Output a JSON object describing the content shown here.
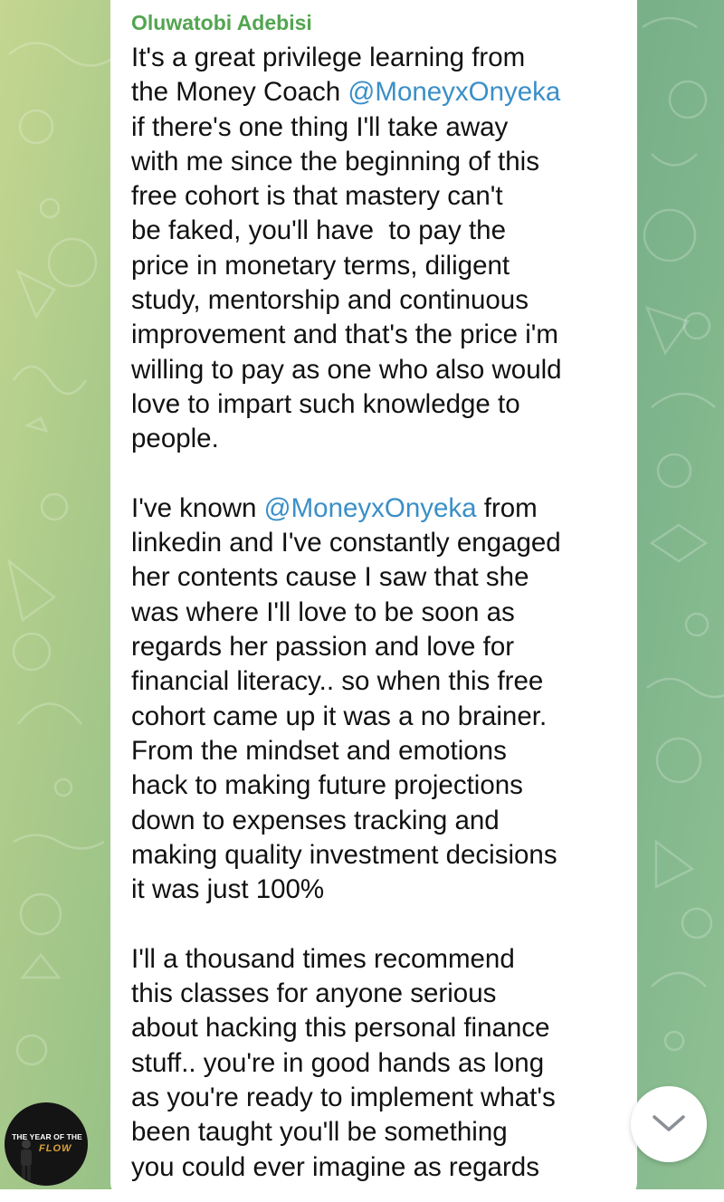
{
  "colors": {
    "sender_name": "#52a550",
    "mention": "#3a8fc7",
    "bubble": "#ffffff",
    "message_text": "#111111"
  },
  "message": {
    "sender": "Oluwatobi Adebisi",
    "lines": [
      [
        {
          "t": "It's a great privilege learning from"
        }
      ],
      [
        {
          "t": "the Money Coach "
        },
        {
          "t": "@MoneyxOnyeka",
          "mention": true
        }
      ],
      [
        {
          "t": "if there's one thing I'll take away"
        }
      ],
      [
        {
          "t": "with me since the beginning of this"
        }
      ],
      [
        {
          "t": "free cohort is that mastery can't"
        }
      ],
      [
        {
          "t": "be faked, you'll have  to pay the"
        }
      ],
      [
        {
          "t": "price in monetary terms, diligent"
        }
      ],
      [
        {
          "t": "study, mentorship and continuous"
        }
      ],
      [
        {
          "t": "improvement and that's the price i'm"
        }
      ],
      [
        {
          "t": "willing to pay as one who also would"
        }
      ],
      [
        {
          "t": "love to impart such knowledge to"
        }
      ],
      [
        {
          "t": "people."
        }
      ],
      [
        {
          "t": ""
        }
      ],
      [
        {
          "t": "I've known "
        },
        {
          "t": "@MoneyxOnyeka",
          "mention": true
        },
        {
          "t": " from"
        }
      ],
      [
        {
          "t": "linkedin and I've constantly engaged"
        }
      ],
      [
        {
          "t": "her contents cause I saw that she"
        }
      ],
      [
        {
          "t": "was where I'll love to be soon as"
        }
      ],
      [
        {
          "t": "regards her passion and love for"
        }
      ],
      [
        {
          "t": "financial literacy.. so when this free"
        }
      ],
      [
        {
          "t": "cohort came up it was a no brainer."
        }
      ],
      [
        {
          "t": "From the mindset and emotions"
        }
      ],
      [
        {
          "t": "hack to making future projections"
        }
      ],
      [
        {
          "t": "down to expenses tracking and"
        }
      ],
      [
        {
          "t": "making quality investment decisions"
        }
      ],
      [
        {
          "t": "it was just 100%"
        }
      ],
      [
        {
          "t": ""
        }
      ],
      [
        {
          "t": "I'll a thousand times recommend"
        }
      ],
      [
        {
          "t": "this classes for anyone serious"
        }
      ],
      [
        {
          "t": "about hacking this personal finance"
        }
      ],
      [
        {
          "t": "stuff.. you're in good hands as long"
        }
      ],
      [
        {
          "t": "as you're ready to implement what's"
        }
      ],
      [
        {
          "t": "been taught you'll be something"
        }
      ],
      [
        {
          "t": "you could ever imagine as regards"
        }
      ]
    ]
  },
  "avatar": {
    "title": "THE YEAR OF THE",
    "word": "FLOW"
  },
  "scroll_button": {
    "icon": "chevron-down-icon"
  }
}
